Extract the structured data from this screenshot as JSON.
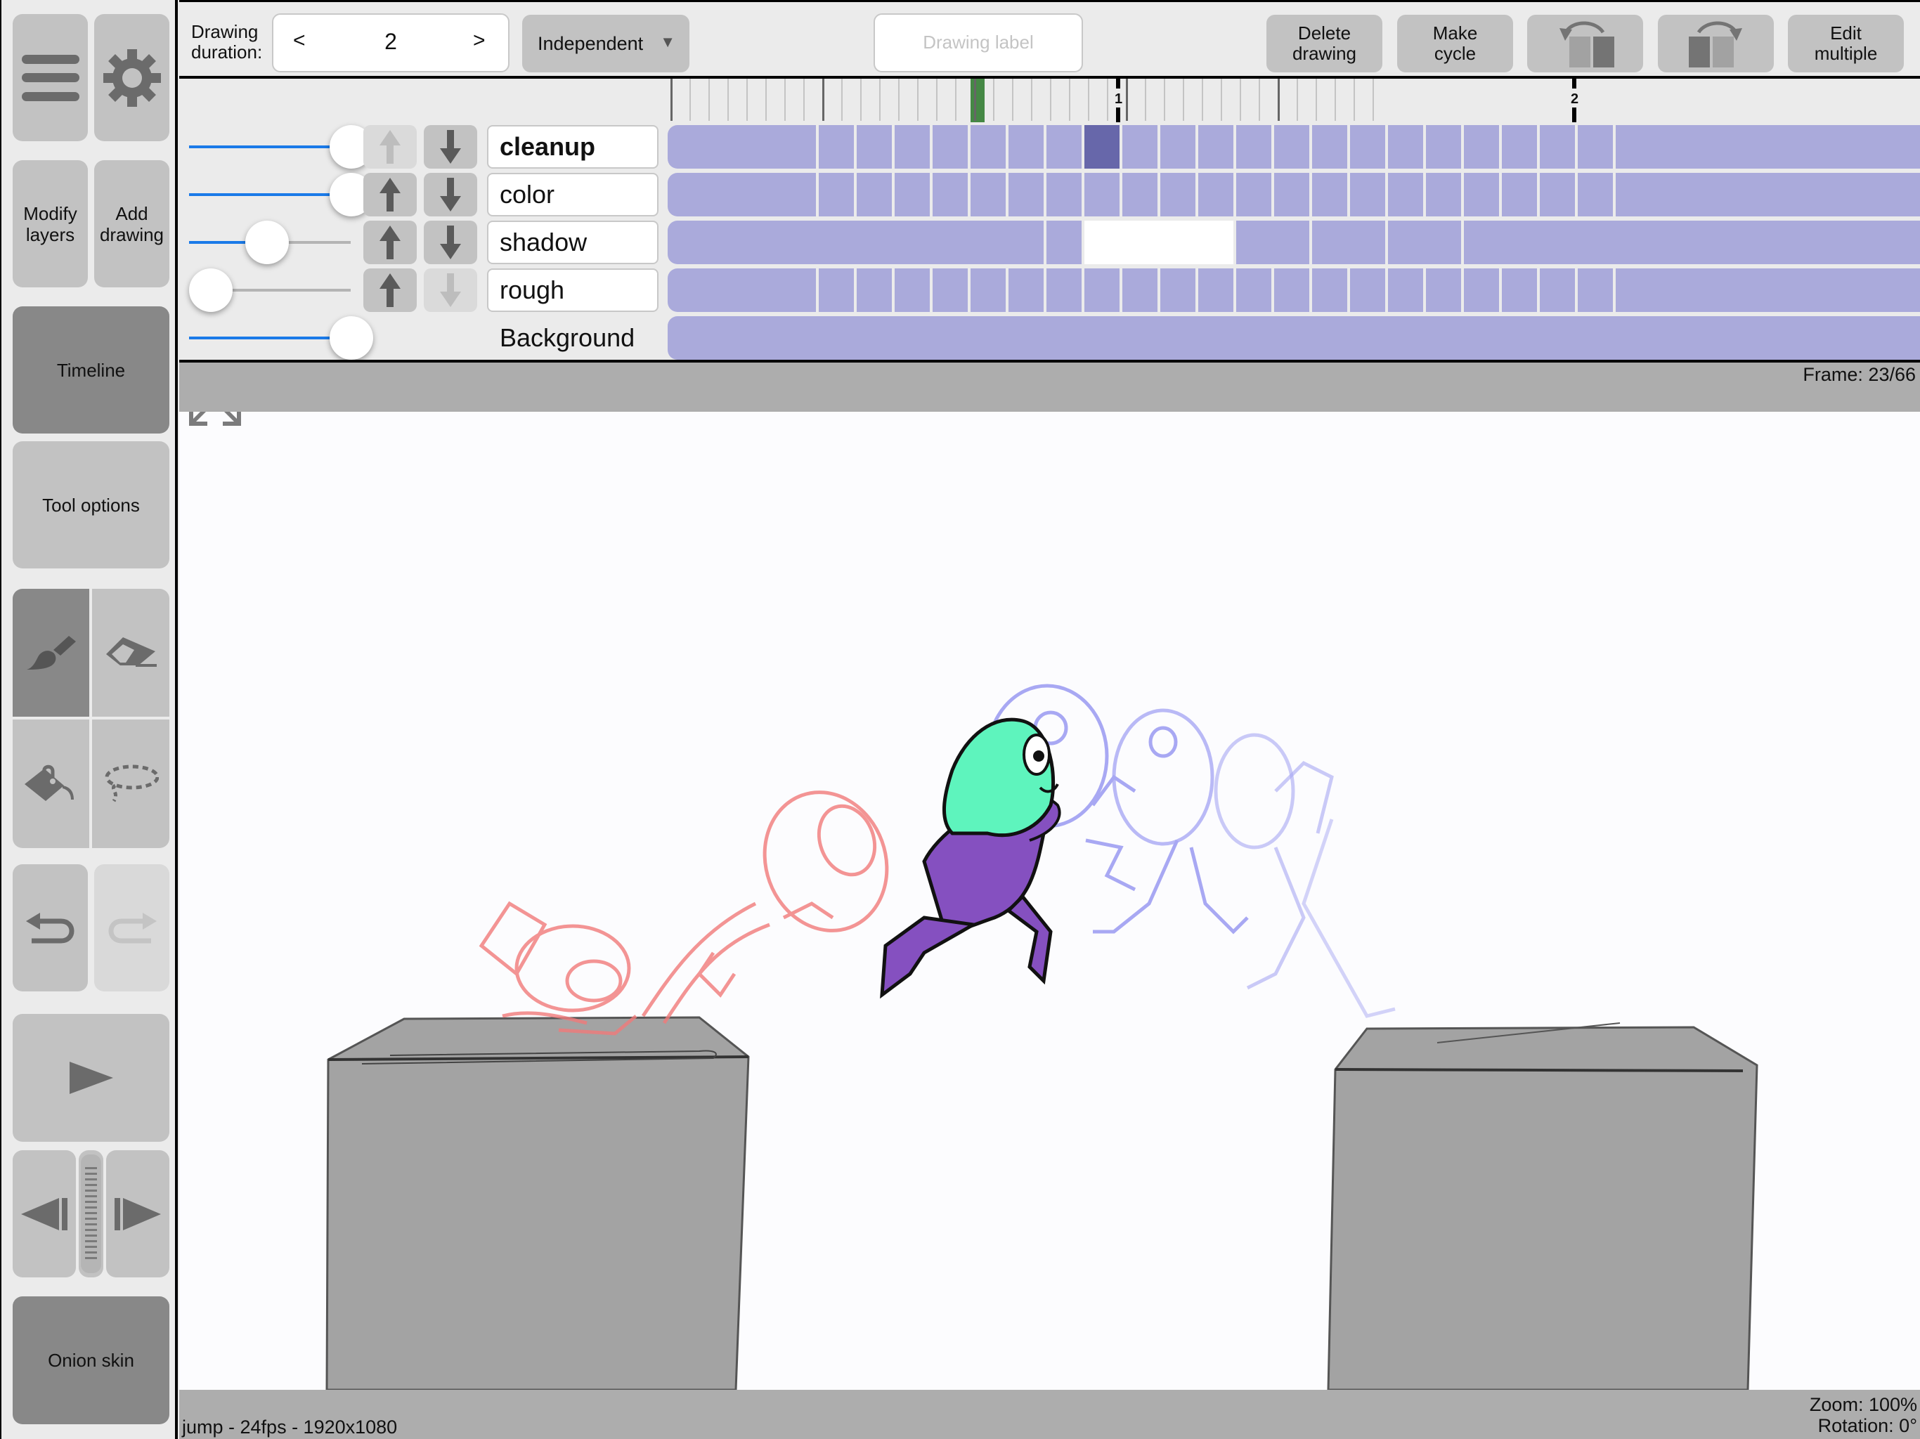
{
  "sidebar": {
    "menu_icon": "hamburger-menu-icon",
    "settings_icon": "gear-icon",
    "modify_layers": "Modify\nlayers",
    "modify_layers_l1": "Modify",
    "modify_layers_l2": "layers",
    "add_drawing_l1": "Add",
    "add_drawing_l2": "drawing",
    "timeline": "Timeline",
    "tool_options": "Tool options",
    "tools": [
      {
        "name": "brush",
        "icon": "brush-icon",
        "active": true
      },
      {
        "name": "eraser",
        "icon": "eraser-icon",
        "active": false
      },
      {
        "name": "fill",
        "icon": "paint-bucket-icon",
        "active": false
      },
      {
        "name": "lasso",
        "icon": "lasso-icon",
        "active": false
      }
    ],
    "undo_icon": "undo-icon",
    "redo_icon": "redo-icon",
    "play_icon": "play-icon",
    "prev_frame_icon": "step-back-icon",
    "next_frame_icon": "step-forward-icon",
    "scrub_icon": "frame-scrubber-icon",
    "onion_skin": "Onion skin"
  },
  "toolbar": {
    "duration_label_l1": "Drawing",
    "duration_label_l2": "duration:",
    "duration_prev": "<",
    "duration_value": "2",
    "duration_next": ">",
    "mode_select": "Independent",
    "mode_arrow": "▼",
    "drawing_label_placeholder": "Drawing label",
    "delete_drawing_l1": "Delete",
    "delete_drawing_l2": "drawing",
    "make_cycle_l1": "Make",
    "make_cycle_l2": "cycle",
    "move_left_icon": "move-drawing-left-icon",
    "move_right_icon": "move-drawing-right-icon",
    "edit_multiple_l1": "Edit",
    "edit_multiple_l2": "multiple"
  },
  "timeline": {
    "second_markers": [
      "1",
      "2"
    ],
    "current_frame": 23,
    "layers": [
      {
        "name": "cleanup",
        "opacity": 1.0,
        "bold": true,
        "up_enabled": false,
        "down_enabled": true,
        "cells": [
          [
            0,
            4
          ],
          [
            4,
            1
          ],
          [
            5,
            1
          ],
          [
            6,
            1
          ],
          [
            7,
            1
          ],
          [
            8,
            1
          ],
          [
            9,
            1
          ],
          [
            10,
            1
          ],
          [
            11,
            1
          ],
          [
            12,
            1
          ],
          [
            13,
            1
          ],
          [
            14,
            1
          ],
          [
            15,
            1
          ],
          [
            16,
            1
          ],
          [
            17,
            1
          ],
          [
            18,
            1
          ],
          [
            19,
            1
          ],
          [
            20,
            1
          ],
          [
            21,
            1
          ],
          [
            22,
            1
          ],
          [
            23,
            1
          ],
          [
            24,
            1
          ],
          [
            25,
            8
          ]
        ],
        "selected_index": 8
      },
      {
        "name": "color",
        "opacity": 1.0,
        "bold": false,
        "up_enabled": true,
        "down_enabled": true,
        "cells": [
          [
            0,
            4
          ],
          [
            4,
            1
          ],
          [
            5,
            1
          ],
          [
            6,
            1
          ],
          [
            7,
            1
          ],
          [
            8,
            1
          ],
          [
            9,
            1
          ],
          [
            10,
            1
          ],
          [
            11,
            1
          ],
          [
            12,
            1
          ],
          [
            13,
            1
          ],
          [
            14,
            1
          ],
          [
            15,
            1
          ],
          [
            16,
            1
          ],
          [
            17,
            1
          ],
          [
            18,
            1
          ],
          [
            19,
            1
          ],
          [
            20,
            1
          ],
          [
            21,
            1
          ],
          [
            22,
            1
          ],
          [
            23,
            1
          ],
          [
            24,
            1
          ],
          [
            25,
            8
          ]
        ],
        "selected_index": -1
      },
      {
        "name": "shadow",
        "opacity": 0.4,
        "bold": false,
        "up_enabled": true,
        "down_enabled": true,
        "cells": [
          [
            0,
            10
          ],
          [
            10,
            1
          ],
          [
            11,
            4,
            "empty"
          ],
          [
            15,
            2
          ],
          [
            17,
            2
          ],
          [
            19,
            2
          ],
          [
            21,
            12
          ]
        ],
        "selected_index": -1
      },
      {
        "name": "rough",
        "opacity": 0.0,
        "bold": false,
        "up_enabled": true,
        "down_enabled": false,
        "cells": [
          [
            0,
            4
          ],
          [
            4,
            1
          ],
          [
            5,
            1
          ],
          [
            6,
            1
          ],
          [
            7,
            1
          ],
          [
            8,
            1
          ],
          [
            9,
            1
          ],
          [
            10,
            1
          ],
          [
            11,
            1
          ],
          [
            12,
            1
          ],
          [
            13,
            1
          ],
          [
            14,
            1
          ],
          [
            15,
            1
          ],
          [
            16,
            1
          ],
          [
            17,
            1
          ],
          [
            18,
            1
          ],
          [
            19,
            1
          ],
          [
            20,
            1
          ],
          [
            21,
            1
          ],
          [
            22,
            1
          ],
          [
            23,
            1
          ],
          [
            24,
            1
          ],
          [
            25,
            8
          ]
        ],
        "selected_index": -1
      },
      {
        "name": "Background",
        "opacity": 1.0,
        "bold": false,
        "is_background": true,
        "cells": [
          [
            0,
            33
          ]
        ],
        "selected_index": -1
      }
    ],
    "colors": {
      "cell": "#aaaadb",
      "selected_cell": "#6767aa",
      "playhead": "#458845",
      "slider_fill": "#1a7ae8"
    }
  },
  "canvas": {
    "fullscreen_icon": "expand-fullscreen-icon",
    "frame_indicator": "Frame: 23/66",
    "onion_prev_color": "#f07a7a",
    "onion_next_color": "#8c8cf0",
    "character_head_color": "#5ef4bd",
    "character_body_color": "#8550c0"
  },
  "status": {
    "project_info": "jump - 24fps - 1920x1080",
    "zoom": "Zoom: 100%",
    "rotation": "Rotation: 0°"
  }
}
